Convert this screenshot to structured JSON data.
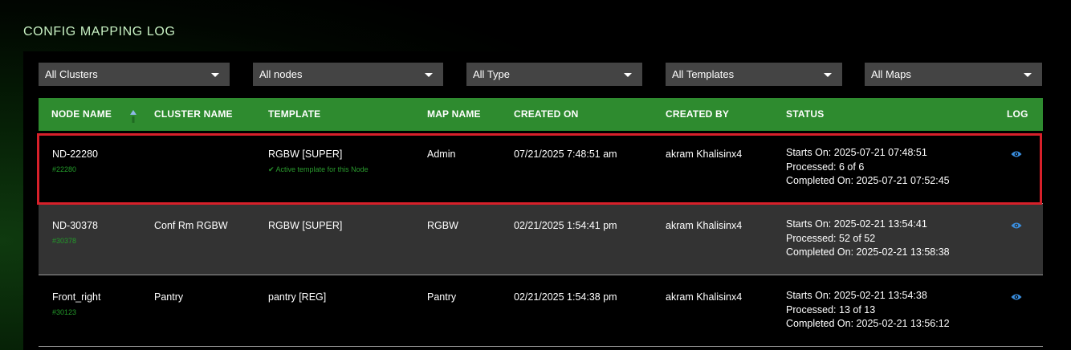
{
  "page": {
    "title": "CONFIG MAPPING LOG"
  },
  "filters": {
    "clusters": "All Clusters",
    "nodes": "All nodes",
    "type": "All Type",
    "templates": "All Templates",
    "maps": "All Maps"
  },
  "table": {
    "headers": {
      "node_name": "NODE NAME",
      "cluster_name": "CLUSTER NAME",
      "template": "TEMPLATE",
      "map_name": "MAP NAME",
      "created_on": "CREATED ON",
      "created_by": "CREATED BY",
      "status": "STATUS",
      "log": "LOG"
    },
    "rows": [
      {
        "node_name": "ND-22280",
        "node_id": "#22280",
        "cluster_name": "",
        "template": "RGBW [SUPER]",
        "template_note": "✔ Active template for this Node",
        "map_name": "Admin",
        "created_on": "07/21/2025 7:48:51 am",
        "created_by": "akram Khalisinx4",
        "status_start": "Starts On: 2025-07-21 07:48:51",
        "status_processed": "Processed: 6 of 6",
        "status_completed": "Completed On: 2025-07-21 07:52:45"
      },
      {
        "node_name": "ND-30378",
        "node_id": "#30378",
        "cluster_name": "Conf Rm RGBW",
        "template": "RGBW [SUPER]",
        "template_note": "",
        "map_name": "RGBW",
        "created_on": "02/21/2025 1:54:41 pm",
        "created_by": "akram Khalisinx4",
        "status_start": "Starts On: 2025-02-21 13:54:41",
        "status_processed": "Processed: 52 of 52",
        "status_completed": "Completed On: 2025-02-21 13:58:38"
      },
      {
        "node_name": "Front_right",
        "node_id": "#30123",
        "cluster_name": "Pantry",
        "template": "pantry [REG]",
        "template_note": "",
        "map_name": "Pantry",
        "created_on": "02/21/2025 1:54:38 pm",
        "created_by": "akram Khalisinx4",
        "status_start": "Starts On: 2025-02-21 13:54:38",
        "status_processed": "Processed: 13 of 13",
        "status_completed": "Completed On: 2025-02-21 13:56:12"
      }
    ]
  },
  "icons": {
    "sort": "sort-asc-icon",
    "log": "eye-icon",
    "dropdown": "caret-down-icon"
  },
  "colors": {
    "header_bg": "#2e8b2f",
    "highlight_border": "#d7202a",
    "eye": "#3a8fe0",
    "node_id": "#239a2a"
  }
}
